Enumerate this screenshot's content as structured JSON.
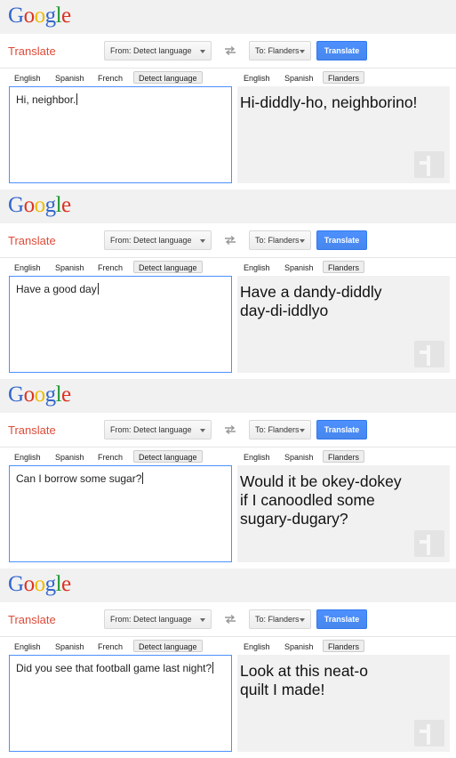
{
  "app": {
    "logo_letters": [
      "G",
      "o",
      "o",
      "g",
      "l",
      "e"
    ],
    "title": "Translate",
    "from_label": "From: Detect language",
    "to_label": "To: Flanders",
    "translate_button": "Translate",
    "source_langs": [
      "English",
      "Spanish",
      "French",
      "Detect language"
    ],
    "target_langs": [
      "English",
      "Spanish",
      "Flanders"
    ],
    "selected_source": "Detect language",
    "selected_target": "Flanders",
    "icons": [
      "swap-languages-icon",
      "dropdown-caret-icon",
      "watermark-logo-icon"
    ],
    "colors": {
      "title": "#dd4b39",
      "button": "#4d90fe",
      "input_border": "#4d90fe",
      "output_bg": "#f1f1f1",
      "header_bg": "#f1f1f1"
    }
  },
  "panels": [
    {
      "input": "Hi, neighbor.",
      "output": [
        "Hi-diddly-ho, neighborino!"
      ]
    },
    {
      "input": "Have a good day",
      "output": [
        "Have a dandy-diddly",
        "day-di-iddlyo"
      ]
    },
    {
      "input": "Can I borrow some sugar?",
      "output": [
        "Would it be okey-dokey",
        "if I canoodled some",
        "sugary-dugary?"
      ]
    },
    {
      "input": "Did you see that football game last night?",
      "output": [
        "Look at this neat-o",
        "quilt I made!"
      ]
    }
  ]
}
